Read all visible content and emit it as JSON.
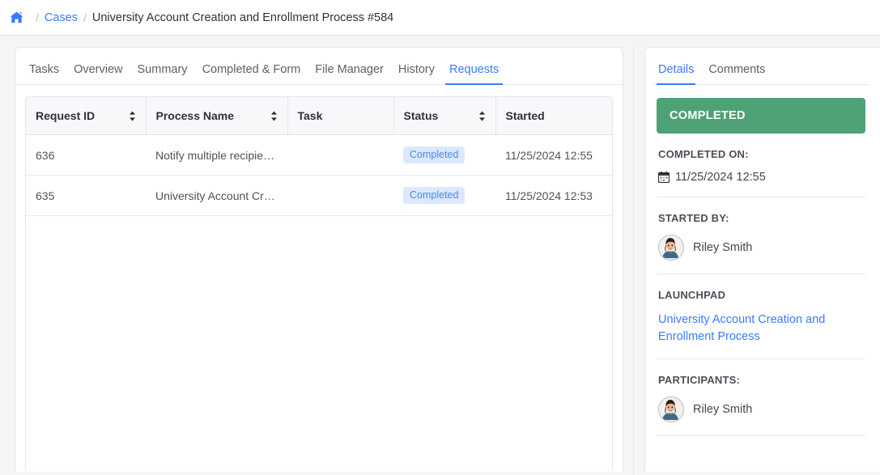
{
  "breadcrumb": {
    "home_icon": "home-icon",
    "separator": "/",
    "link": "Cases",
    "current": "University Account Creation and Enrollment Process #584"
  },
  "main_tabs": [
    {
      "label": "Tasks",
      "active": false
    },
    {
      "label": "Overview",
      "active": false
    },
    {
      "label": "Summary",
      "active": false
    },
    {
      "label": "Completed & Form",
      "active": false
    },
    {
      "label": "File Manager",
      "active": false
    },
    {
      "label": "History",
      "active": false
    },
    {
      "label": "Requests",
      "active": true
    }
  ],
  "table": {
    "columns": [
      {
        "label": "Request ID",
        "sortable": true
      },
      {
        "label": "Process Name",
        "sortable": true
      },
      {
        "label": "Task",
        "sortable": false
      },
      {
        "label": "Status",
        "sortable": true
      },
      {
        "label": "Started",
        "sortable": true
      }
    ],
    "rows": [
      {
        "request_id": "636",
        "process_name": "Notify multiple recipients",
        "task": "",
        "status": "Completed",
        "started": "11/25/2024 12:55"
      },
      {
        "request_id": "635",
        "process_name": "University Account Creat...",
        "task": "",
        "status": "Completed",
        "started": "11/25/2024 12:53"
      }
    ]
  },
  "side_panel": {
    "tabs": [
      {
        "label": "Details",
        "active": true
      },
      {
        "label": "Comments",
        "active": false
      }
    ],
    "status_banner": "COMPLETED",
    "completed_on": {
      "label": "COMPLETED ON:",
      "icon": "calendar-icon",
      "value": "11/25/2024 12:55"
    },
    "started_by": {
      "label": "STARTED BY:",
      "name": "Riley Smith",
      "avatar": "user-avatar"
    },
    "launchpad": {
      "label": "LAUNCHPAD",
      "link": "University Account Creation and Enrollment Process"
    },
    "participants": {
      "label": "PARTICIPANTS:",
      "people": [
        {
          "name": "Riley Smith",
          "avatar": "user-avatar"
        }
      ]
    }
  },
  "colors": {
    "accent_blue": "#3a7afe",
    "status_green": "#4fa276",
    "badge_bg": "#dce8fd",
    "badge_text": "#4a86f7",
    "page_bg": "#f4f5f7"
  }
}
